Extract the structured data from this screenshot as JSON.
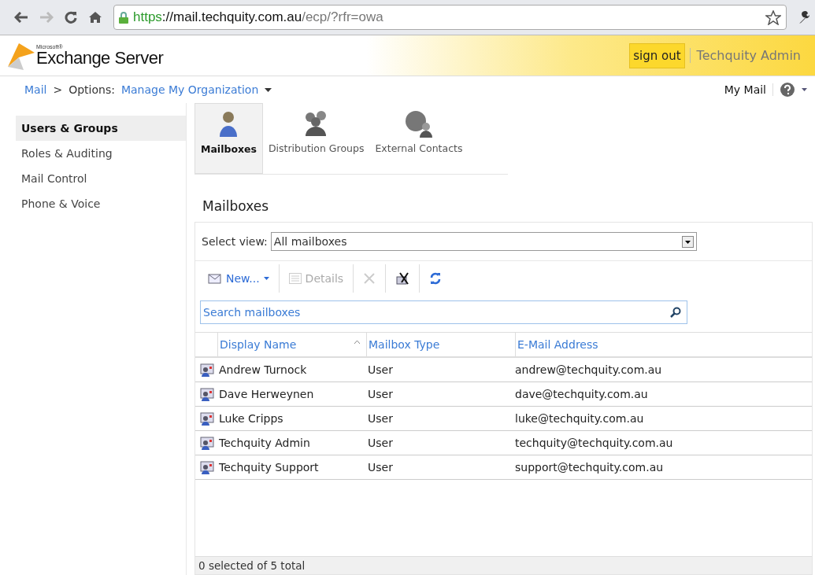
{
  "browser": {
    "url_scheme": "https",
    "url_host": "://mail.techquity.com.au",
    "url_path": "/ecp/?rfr=owa"
  },
  "header": {
    "logo_small": "Microsoft®",
    "logo": "Exchange Server",
    "sign_out": "sign out",
    "user": "Techquity Admin"
  },
  "breadcrumb": {
    "mail": "Mail",
    "separator": ">",
    "options": "Options:",
    "scope": "Manage My Organization",
    "my_mail": "My Mail"
  },
  "sidebar": {
    "items": [
      {
        "label": "Users & Groups",
        "selected": true
      },
      {
        "label": "Roles & Auditing",
        "selected": false
      },
      {
        "label": "Mail Control",
        "selected": false
      },
      {
        "label": "Phone & Voice",
        "selected": false
      }
    ]
  },
  "tabs": [
    {
      "label": "Mailboxes",
      "kind": "person",
      "selected": true
    },
    {
      "label": "Distribution Groups",
      "kind": "group",
      "selected": false
    },
    {
      "label": "External Contacts",
      "kind": "contact",
      "selected": false
    }
  ],
  "panel": {
    "title": "Mailboxes",
    "view_label": "Select view:",
    "view_value": "All mailboxes",
    "toolbar": [
      {
        "kind": "new",
        "label": "New...",
        "disabled": false
      },
      {
        "kind": "details",
        "label": "Details",
        "disabled": true
      },
      {
        "kind": "delete",
        "disabled": true
      },
      {
        "kind": "disable",
        "disabled": false
      },
      {
        "kind": "refresh",
        "disabled": false
      }
    ],
    "search": {
      "placeholder": "Search mailboxes"
    },
    "table": {
      "columns": [
        "Display Name",
        "Mailbox Type",
        "E-Mail Address"
      ],
      "rows": [
        [
          "Andrew Turnock",
          "User",
          "andrew@techquity.com.au"
        ],
        [
          "Dave Herweynen",
          "User",
          "dave@techquity.com.au"
        ],
        [
          "Luke Cripps",
          "User",
          "luke@techquity.com.au"
        ],
        [
          "Techquity Admin",
          "User",
          "techquity@techquity.com.au"
        ],
        [
          "Techquity Support",
          "User",
          "support@techquity.com.au"
        ]
      ]
    },
    "status": "0 selected of 5 total"
  }
}
